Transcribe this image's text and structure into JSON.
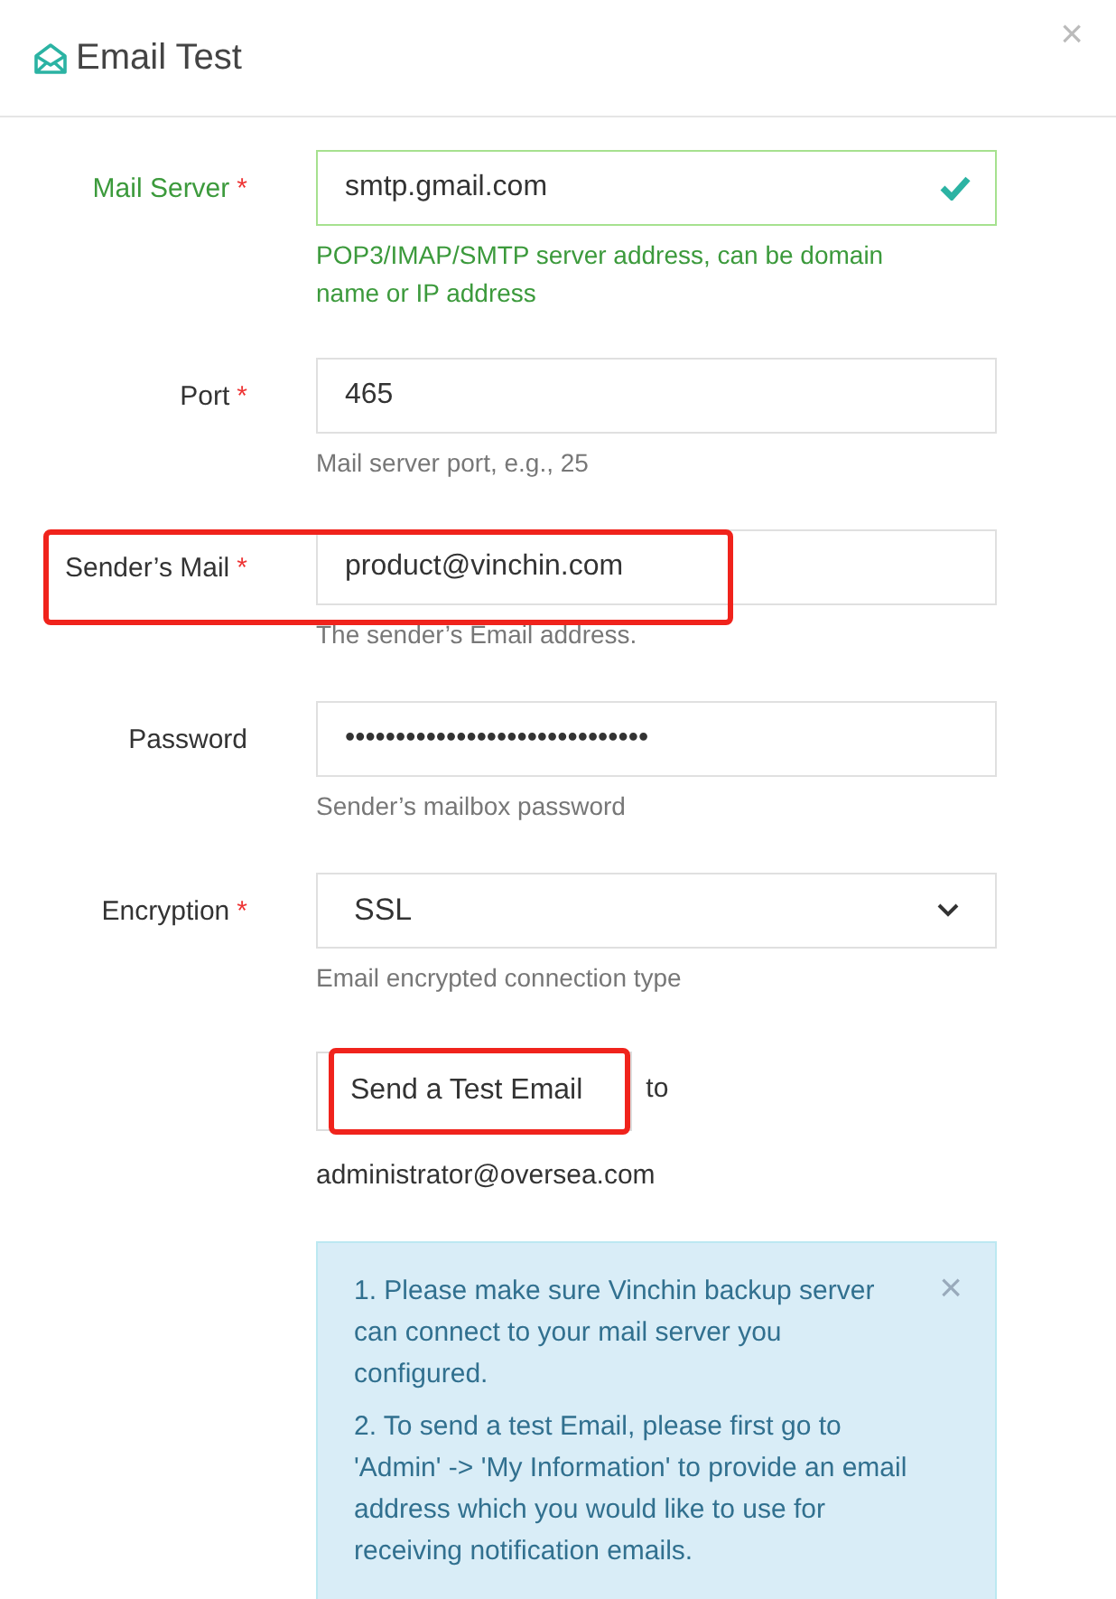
{
  "dialog": {
    "title": "Email Test",
    "close": "×"
  },
  "fields": [
    {
      "kind": "text",
      "label": "Mail Server",
      "required_mark": "*",
      "value": "smtp.gmail.com",
      "hint": "POP3/IMAP/SMTP server address, can be domain name or IP address",
      "valid": true,
      "highlighted": false
    },
    {
      "kind": "text",
      "label": "Port",
      "required_mark": "*",
      "value": "465",
      "hint": "Mail server port, e.g., 25",
      "valid": false,
      "highlighted": false
    },
    {
      "kind": "text",
      "label": "Sender’s Mail",
      "required_mark": "*",
      "value": "product@vinchin.com",
      "hint": "The sender’s Email address.",
      "valid": false,
      "highlighted": true
    },
    {
      "kind": "password",
      "label": "Password",
      "value": "••••••••••••••••••••••••••••••",
      "hint": "Sender’s mailbox password",
      "valid": false,
      "highlighted": false
    },
    {
      "kind": "select",
      "label": "Encryption",
      "required_mark": "*",
      "value": "SSL",
      "hint": "Email encrypted connection type",
      "valid": false,
      "highlighted": false
    }
  ],
  "test": {
    "button": "Send a Test Email",
    "highlighted": true,
    "to": "to",
    "recipient": "administrator@oversea.com"
  },
  "alert": {
    "close": "×",
    "items": [
      "1. Please make sure Vinchin backup server can connect to your mail server you configured.",
      "2. To send a test Email, please first go to 'Admin' -> 'My Information' to provide an email address which you would like to use for receiving notification emails."
    ]
  }
}
